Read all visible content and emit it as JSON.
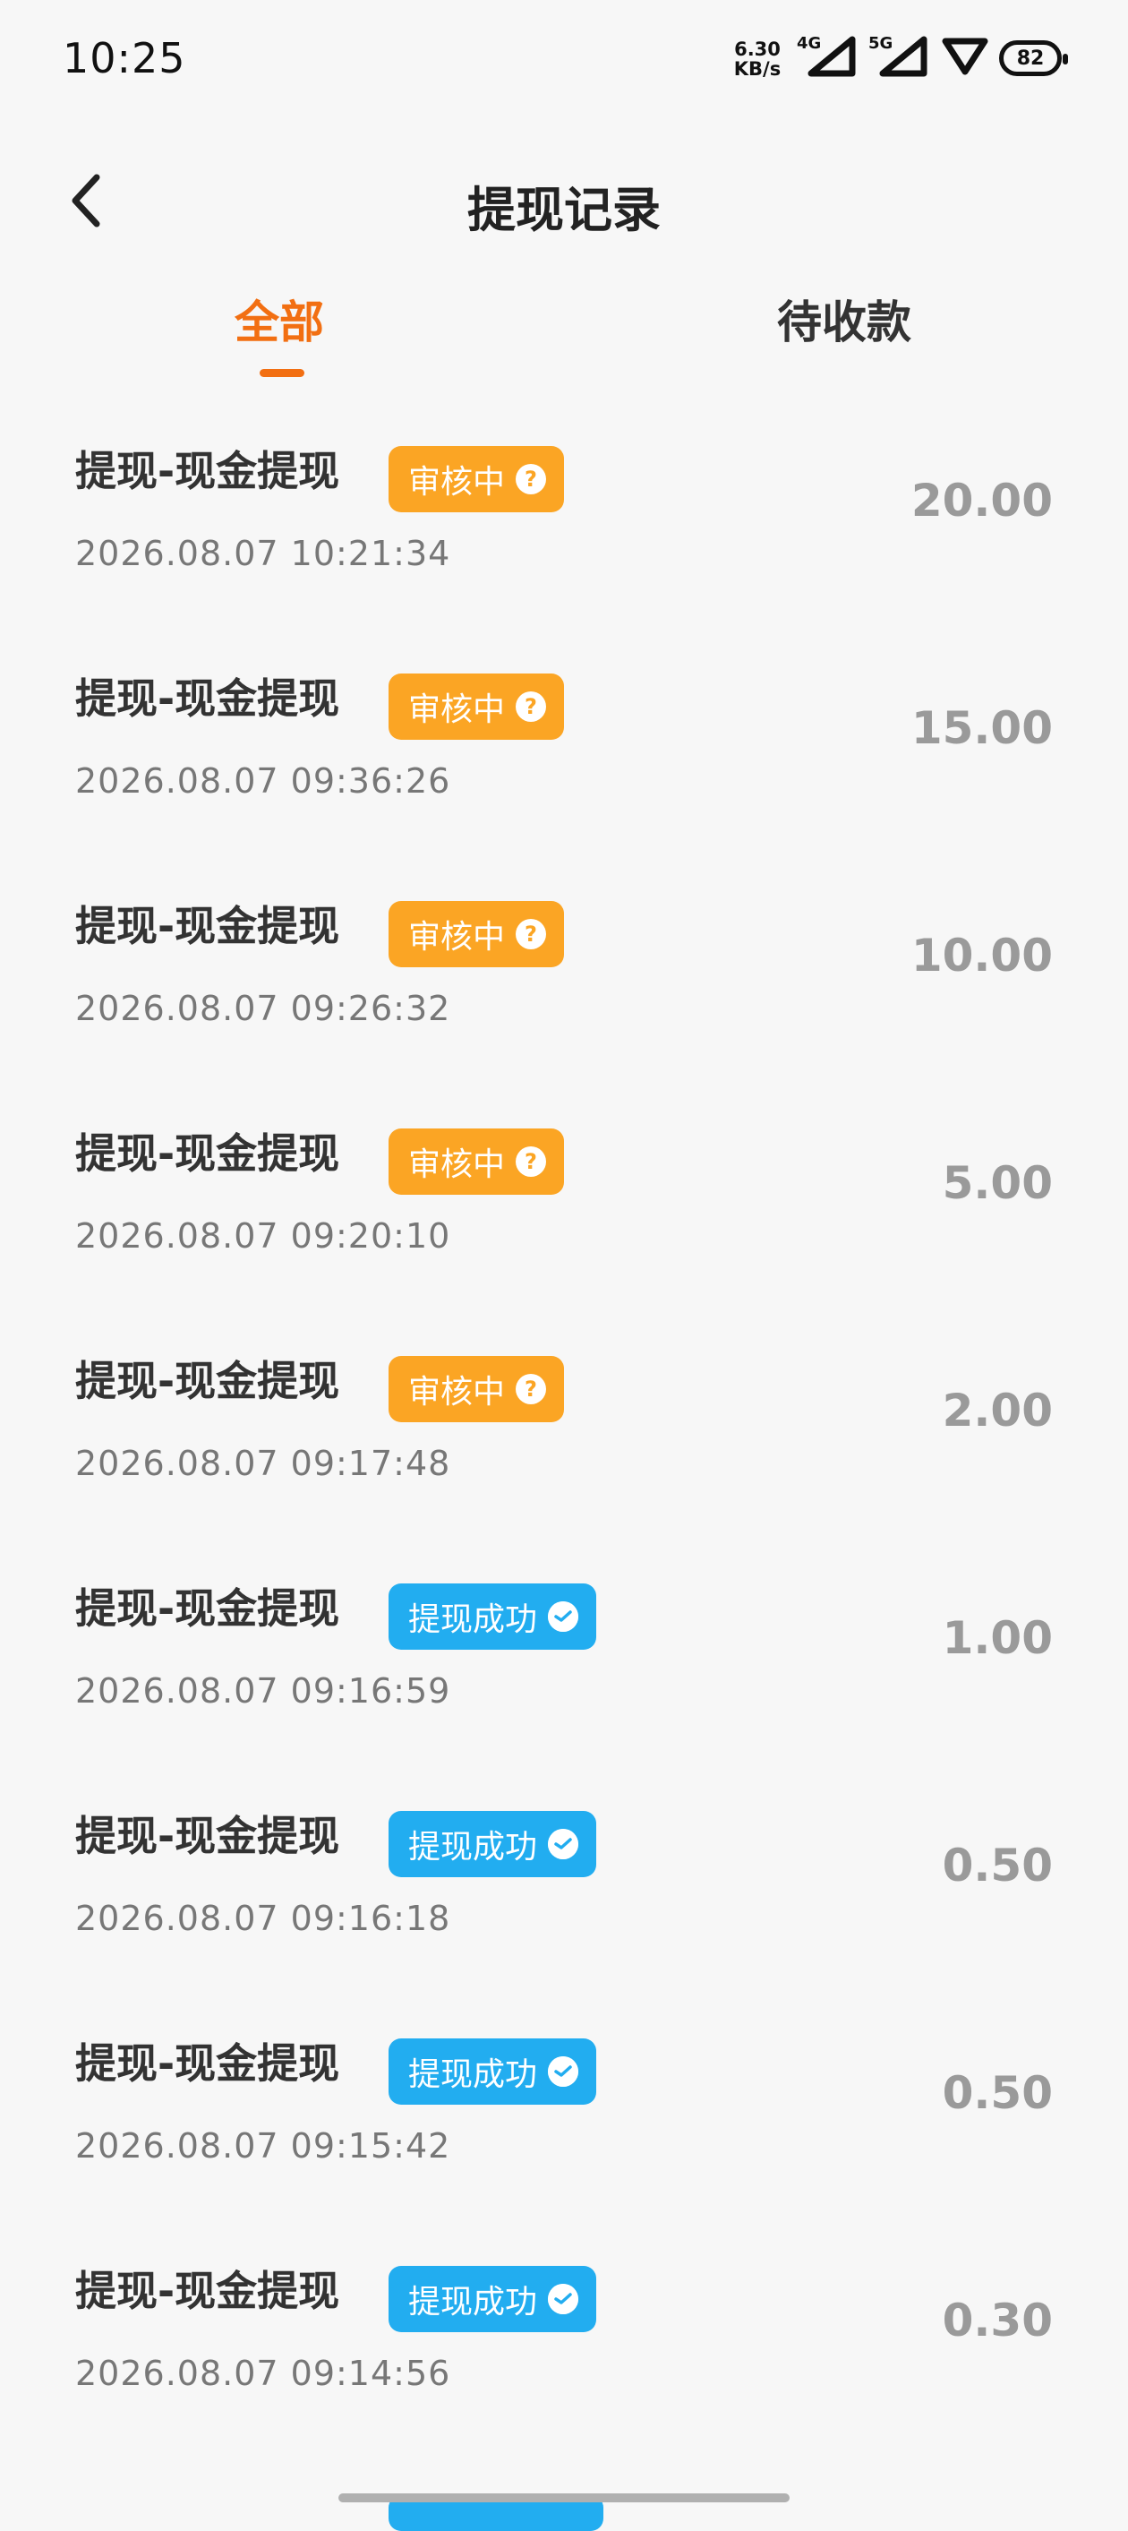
{
  "status_bar": {
    "time": "10:25",
    "net_speed_value": "6.30",
    "net_speed_unit": "KB/s",
    "signal_1_label": "4G",
    "signal_2_label": "5G",
    "battery": "82"
  },
  "header": {
    "title": "提现记录",
    "back_icon": "chevron-left-icon"
  },
  "tabs": [
    {
      "label": "全部",
      "active": true
    },
    {
      "label": "待收款",
      "active": false
    }
  ],
  "records": [
    {
      "title": "提现-现金提现",
      "status": "审核中",
      "status_type": "review",
      "time": "2026.08.07 10:21:34",
      "amount": "20.00"
    },
    {
      "title": "提现-现金提现",
      "status": "审核中",
      "status_type": "review",
      "time": "2026.08.07 09:36:26",
      "amount": "15.00"
    },
    {
      "title": "提现-现金提现",
      "status": "审核中",
      "status_type": "review",
      "time": "2026.08.07 09:26:32",
      "amount": "10.00"
    },
    {
      "title": "提现-现金提现",
      "status": "审核中",
      "status_type": "review",
      "time": "2026.08.07 09:20:10",
      "amount": "5.00"
    },
    {
      "title": "提现-现金提现",
      "status": "审核中",
      "status_type": "review",
      "time": "2026.08.07 09:17:48",
      "amount": "2.00"
    },
    {
      "title": "提现-现金提现",
      "status": "提现成功",
      "status_type": "success",
      "time": "2026.08.07 09:16:59",
      "amount": "1.00"
    },
    {
      "title": "提现-现金提现",
      "status": "提现成功",
      "status_type": "success",
      "time": "2026.08.07 09:16:18",
      "amount": "0.50"
    },
    {
      "title": "提现-现金提现",
      "status": "提现成功",
      "status_type": "success",
      "time": "2026.08.07 09:15:42",
      "amount": "0.50"
    },
    {
      "title": "提现-现金提现",
      "status": "提现成功",
      "status_type": "success",
      "time": "2026.08.07 09:14:56",
      "amount": "0.30"
    }
  ],
  "colors": {
    "accent": "#f26f12",
    "review_badge": "#fba524",
    "success_badge": "#22adf0",
    "amount_text": "#9a9a9a"
  }
}
